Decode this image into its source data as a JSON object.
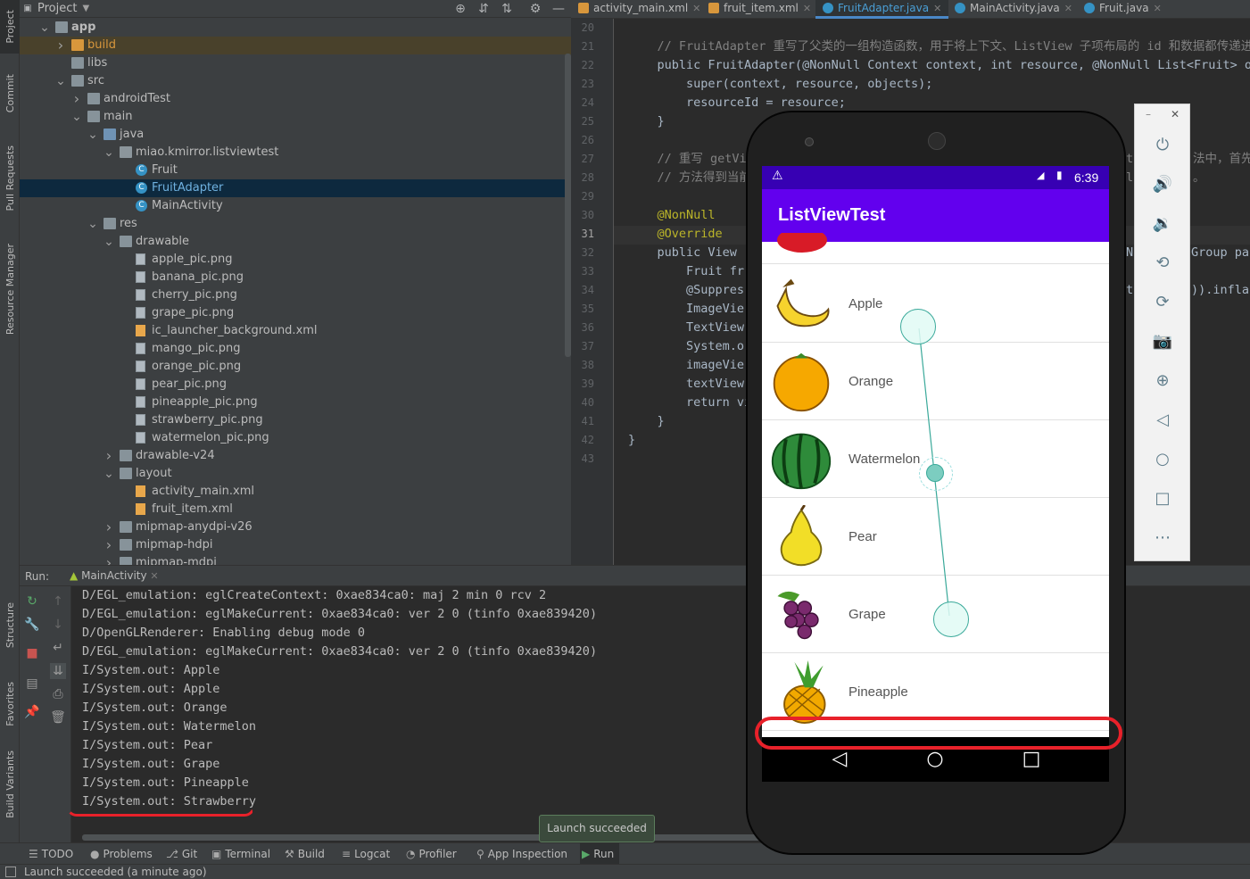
{
  "left_stripe": {
    "project": "Project",
    "commit": "Commit",
    "pull_requests": "Pull Requests",
    "resource_manager": "Resource Manager",
    "structure": "Structure",
    "favorites": "Favorites",
    "build_variants": "Build Variants"
  },
  "project_panel": {
    "title": "Project",
    "tree": [
      {
        "label": "app",
        "bold": true
      },
      {
        "label": "build"
      },
      {
        "label": "libs"
      },
      {
        "label": "src"
      },
      {
        "label": "androidTest"
      },
      {
        "label": "main"
      },
      {
        "label": "java"
      },
      {
        "label": "miao.kmirror.listviewtest"
      },
      {
        "label": "Fruit"
      },
      {
        "label": "FruitAdapter"
      },
      {
        "label": "MainActivity"
      },
      {
        "label": "res"
      },
      {
        "label": "drawable"
      },
      {
        "label": "apple_pic.png"
      },
      {
        "label": "banana_pic.png"
      },
      {
        "label": "cherry_pic.png"
      },
      {
        "label": "grape_pic.png"
      },
      {
        "label": "ic_launcher_background.xml"
      },
      {
        "label": "mango_pic.png"
      },
      {
        "label": "orange_pic.png"
      },
      {
        "label": "pear_pic.png"
      },
      {
        "label": "pineapple_pic.png"
      },
      {
        "label": "strawberry_pic.png"
      },
      {
        "label": "watermelon_pic.png"
      },
      {
        "label": "drawable-v24"
      },
      {
        "label": "layout"
      },
      {
        "label": "activity_main.xml"
      },
      {
        "label": "fruit_item.xml"
      },
      {
        "label": "mipmap-anydpi-v26"
      },
      {
        "label": "mipmap-hdpi"
      },
      {
        "label": "mipmap-mdpi"
      }
    ]
  },
  "editor": {
    "tabs": [
      "activity_main.xml",
      "fruit_item.xml",
      "FruitAdapter.java",
      "MainActivity.java",
      "Fruit.java"
    ],
    "active_tab": 2,
    "line_numbers": [
      "20",
      "21",
      "22",
      "23",
      "24",
      "25",
      "26",
      "27",
      "28",
      "29",
      "30",
      "31",
      "32",
      "33",
      "34",
      "35",
      "36",
      "37",
      "38",
      "39",
      "40",
      "41",
      "42",
      "43"
    ],
    "code": [
      "",
      "    // FruitAdapter 重写了父类的一组构造函数，用于将上下文、ListView 子项布局的 id 和数据都传递进来",
      "    public FruitAdapter(@NonNull Context context, int resource, @NonNull List<Fruit> obj",
      "        super(context, resource, objects);",
      "        resourceId = resource;",
      "    }",
      "",
      "    // 重写 getVi",
      "    // 方法得到当前",
      "",
      "    @NonNull",
      "    @Override",
      "    public View",
      "        Fruit fr",
      "        @Suppres",
      "        ImageVie",
      "        TextView",
      "        System.o",
      "        imageVie",
      "        textView",
      "        return vi",
      "    }",
      "}",
      ""
    ],
    "right_fragments": {
      "l27": "法中，首先",
      "l28": "。",
      "l32a": "Group par",
      "l34": ")).infla",
      "l27b": "t",
      "l28b": "l",
      "l32b": "N",
      "l34b": "t"
    }
  },
  "run_panel": {
    "label": "Run:",
    "config": "MainActivity",
    "console": [
      "D/EGL_emulation: eglCreateContext: 0xae834ca0: maj 2 min 0 rcv 2",
      "D/EGL_emulation: eglMakeCurrent: 0xae834ca0: ver 2 0 (tinfo 0xae839420)",
      "D/OpenGLRenderer: Enabling debug mode 0",
      "D/EGL_emulation: eglMakeCurrent: 0xae834ca0: ver 2 0 (tinfo 0xae839420)",
      "I/System.out: Apple",
      "I/System.out: Apple",
      "I/System.out: Orange",
      "I/System.out: Watermelon",
      "I/System.out: Pear",
      "I/System.out: Grape",
      "I/System.out: Pineapple",
      "I/System.out: Strawberry"
    ]
  },
  "bottom_toolbar": [
    "TODO",
    "Problems",
    "Git",
    "Terminal",
    "Build",
    "Logcat",
    "Profiler",
    "App Inspection",
    "Run"
  ],
  "status_text": "Launch succeeded (a minute ago)",
  "tooltip": "Launch succeeded",
  "emulator": {
    "time": "6:39",
    "app_title": "ListViewTest",
    "fruits": [
      "Apple",
      "Orange",
      "Watermelon",
      "Pear",
      "Grape",
      "Pineapple"
    ],
    "accent": "#6200ee",
    "statusbar_color": "#3700b3"
  }
}
